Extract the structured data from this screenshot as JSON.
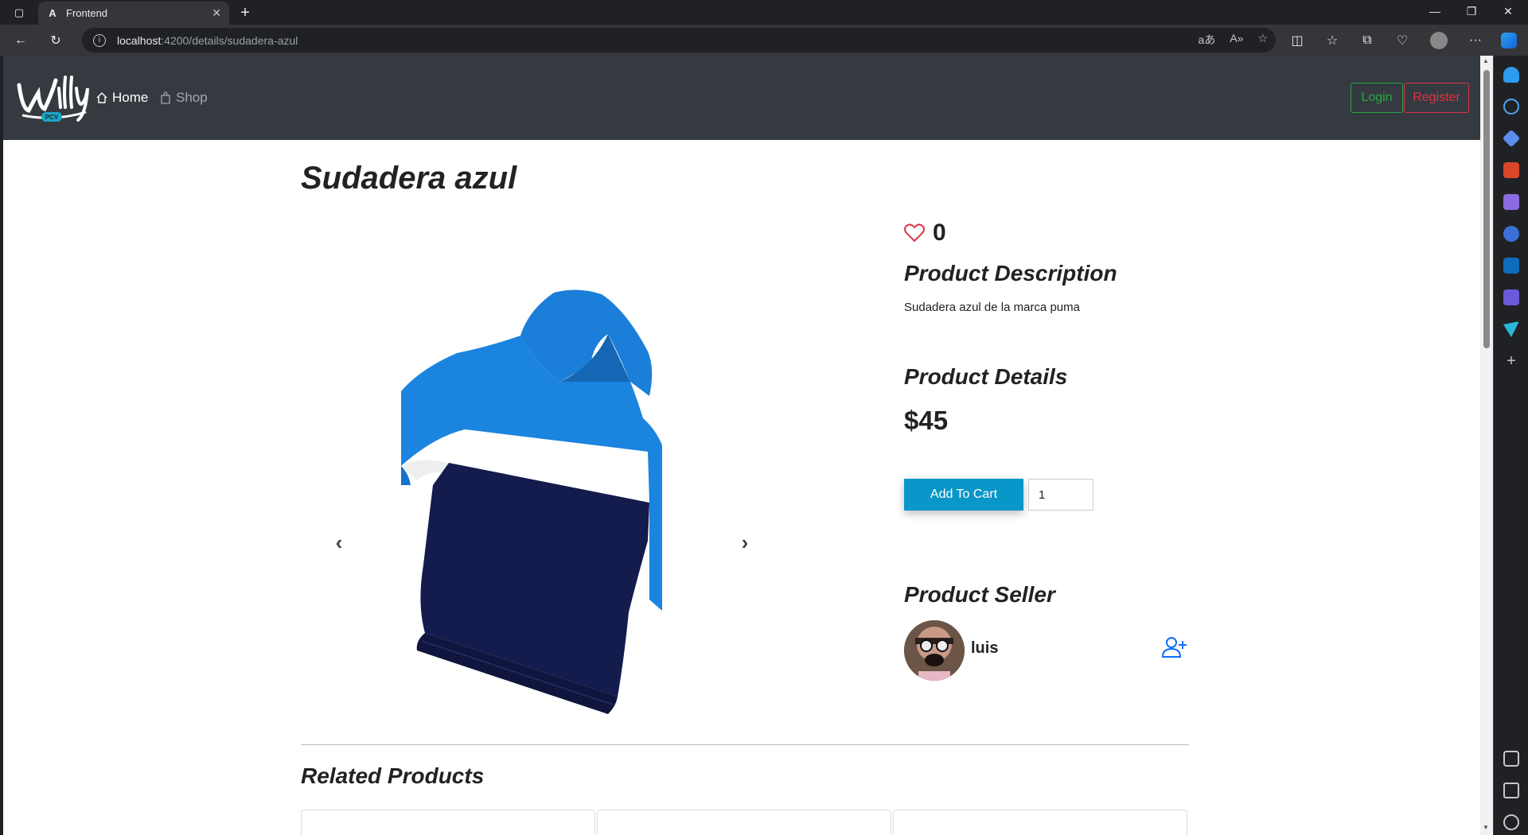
{
  "browser": {
    "tab_title": "Frontend",
    "tab_favicon": "A",
    "url_host": "localhost",
    "url_path": ":4200/details/sudadera-azul"
  },
  "navbar": {
    "brand": "Willy",
    "brand_sub": "PCV",
    "home_label": "Home",
    "shop_label": "Shop",
    "login_label": "Login",
    "register_label": "Register"
  },
  "product": {
    "title": "Sudadera azul",
    "likes": "0",
    "description_heading": "Product Description",
    "description": "Sudadera azul de la marca puma",
    "details_heading": "Product Details",
    "price": "$45",
    "add_to_cart_label": "Add To Cart",
    "quantity": "1",
    "seller_heading": "Product Seller",
    "seller_name": "luis"
  },
  "related": {
    "heading": "Related Products"
  },
  "colors": {
    "navbar_bg": "#343a40",
    "login": "#28a745",
    "register": "#dc3545",
    "cart_button": "#0996c8",
    "heart": "#dc3545",
    "follow_icon": "#0d6efd"
  }
}
